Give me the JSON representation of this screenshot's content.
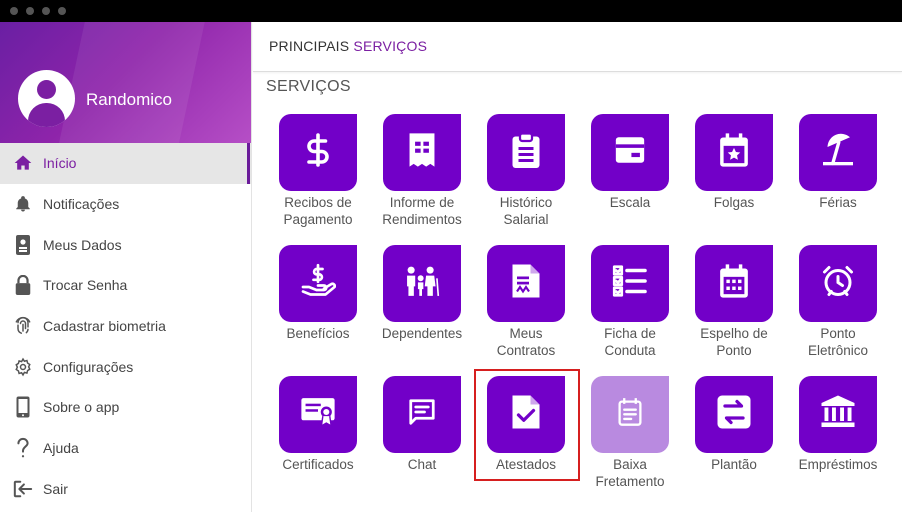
{
  "user": {
    "name": "Randomico"
  },
  "sidebar": {
    "items": [
      {
        "label": "Início",
        "icon": "home-icon",
        "active": true
      },
      {
        "label": "Notificações",
        "icon": "bell-icon"
      },
      {
        "label": "Meus Dados",
        "icon": "badge-icon"
      },
      {
        "label": "Trocar Senha",
        "icon": "lock-icon"
      },
      {
        "label": "Cadastrar biometria",
        "icon": "fingerprint-icon"
      },
      {
        "label": "Configurações",
        "icon": "gear-icon"
      },
      {
        "label": "Sobre o app",
        "icon": "phone-icon"
      },
      {
        "label": "Ajuda",
        "icon": "question-icon"
      },
      {
        "label": "Sair",
        "icon": "logout-icon"
      }
    ]
  },
  "header": {
    "title_part1": "PRINCIPAIS ",
    "title_part2": "SERVIÇOS"
  },
  "section": {
    "title": "SERVIÇOS"
  },
  "services": [
    {
      "line1": "Recibos de",
      "line2": "Pagamento",
      "icon": "dollar-icon"
    },
    {
      "line1": "Informe de",
      "line2": "Rendimentos",
      "icon": "receipt-icon"
    },
    {
      "line1": "Histórico",
      "line2": "Salarial",
      "icon": "clipboard-icon"
    },
    {
      "line1": "Escala",
      "line2": "",
      "icon": "schedule-icon"
    },
    {
      "line1": "Folgas",
      "line2": "",
      "icon": "calendar-star-icon"
    },
    {
      "line1": "Férias",
      "line2": "",
      "icon": "beach-umbrella-icon"
    },
    {
      "line1": "Benefícios",
      "line2": "",
      "icon": "hand-dollar-icon"
    },
    {
      "line1": "Dependentes",
      "line2": "",
      "icon": "family-icon"
    },
    {
      "line1": "Meus",
      "line2": "Contratos",
      "icon": "contract-icon"
    },
    {
      "line1": "Ficha de",
      "line2": "Conduta",
      "icon": "checklist-icon"
    },
    {
      "line1": "Espelho de",
      "line2": "Ponto",
      "icon": "calendar-grid-icon"
    },
    {
      "line1": "Ponto",
      "line2": "Eletrônico",
      "icon": "alarm-clock-icon"
    },
    {
      "line1": "Certificados",
      "line2": "",
      "icon": "certificate-icon"
    },
    {
      "line1": "Chat",
      "line2": "",
      "icon": "chat-icon"
    },
    {
      "line1": "Atestados",
      "line2": "",
      "icon": "document-check-icon"
    },
    {
      "line1": "Baixa",
      "line2": "Fretamento",
      "icon": "note-calendar-icon",
      "disabled": true
    },
    {
      "line1": "Plantão",
      "line2": "",
      "icon": "swap-icon"
    },
    {
      "line1": "Empréstimos",
      "line2": "",
      "icon": "bank-icon"
    }
  ],
  "colors": {
    "primary": "#7200c8",
    "disabled": "#b98ae0",
    "highlight": "#d61f1f"
  }
}
